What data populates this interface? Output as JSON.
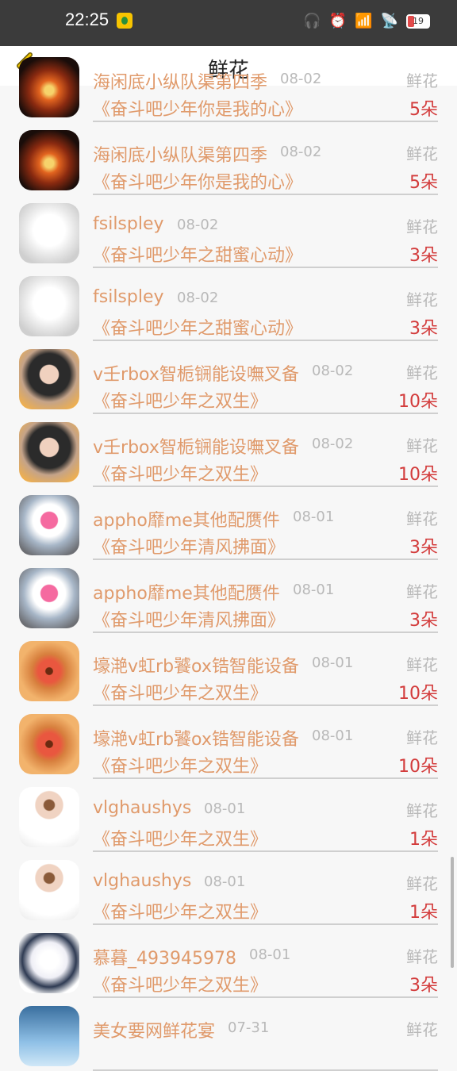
{
  "status": {
    "time": "22:25",
    "battery": "19"
  },
  "header": {
    "title": "鲜花"
  },
  "rows": [
    {
      "name": "海闲底小纵队渠第四季",
      "date": "08-02",
      "type": "鲜花",
      "book": "《奋斗吧少年你是我的心》",
      "count": "5朵",
      "avatar": "fire"
    },
    {
      "name": "海闲底小纵队渠第四季",
      "date": "08-02",
      "type": "鲜花",
      "book": "《奋斗吧少年你是我的心》",
      "count": "5朵",
      "avatar": "fire"
    },
    {
      "name": "fsilspley",
      "date": "08-02",
      "type": "鲜花",
      "book": "《奋斗吧少年之甜蜜心动》",
      "count": "3朵",
      "avatar": "alpaca"
    },
    {
      "name": "fsilspley",
      "date": "08-02",
      "type": "鲜花",
      "book": "《奋斗吧少年之甜蜜心动》",
      "count": "3朵",
      "avatar": "alpaca"
    },
    {
      "name": "v壬rbox智栀锎能设嘸叉备",
      "date": "08-02",
      "type": "鲜花",
      "book": "《奋斗吧少年之双生》",
      "count": "10朵",
      "avatar": "girl"
    },
    {
      "name": "v壬rbox智栀锎能设嘸叉备",
      "date": "08-02",
      "type": "鲜花",
      "book": "《奋斗吧少年之双生》",
      "count": "10朵",
      "avatar": "girl"
    },
    {
      "name": "appho靡me其他配赝件",
      "date": "08-01",
      "type": "鲜花",
      "book": "《奋斗吧少年清风拂面》",
      "count": "3朵",
      "avatar": "coffee"
    },
    {
      "name": "appho靡me其他配赝件",
      "date": "08-01",
      "type": "鲜花",
      "book": "《奋斗吧少年清风拂面》",
      "count": "3朵",
      "avatar": "coffee"
    },
    {
      "name": "壕滟v虹rb饕ox锆智能设备",
      "date": "08-01",
      "type": "鲜花",
      "book": "《奋斗吧少年之双生》",
      "count": "10朵",
      "avatar": "flower"
    },
    {
      "name": "壕滟v虹rb饕ox锆智能设备",
      "date": "08-01",
      "type": "鲜花",
      "book": "《奋斗吧少年之双生》",
      "count": "10朵",
      "avatar": "flower"
    },
    {
      "name": "vlghaushys",
      "date": "08-01",
      "type": "鲜花",
      "book": "《奋斗吧少年之双生》",
      "count": "1朵",
      "avatar": "woman"
    },
    {
      "name": "vlghaushys",
      "date": "08-01",
      "type": "鲜花",
      "book": "《奋斗吧少年之双生》",
      "count": "1朵",
      "avatar": "woman"
    },
    {
      "name": "慕暮_493945978",
      "date": "08-01",
      "type": "鲜花",
      "book": "《奋斗吧少年之双生》",
      "count": "3朵",
      "avatar": "anime"
    },
    {
      "name": "美女要网鲜花宴",
      "date": "07-31",
      "type": "鲜花",
      "book": "",
      "count": "",
      "avatar": "sky"
    }
  ]
}
